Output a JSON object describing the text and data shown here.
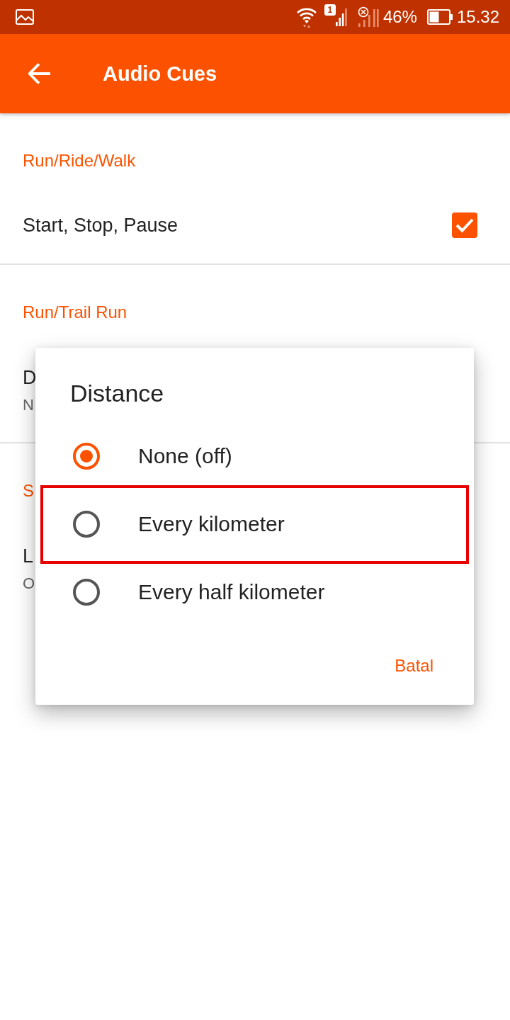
{
  "status_bar": {
    "sim_badge": "1",
    "battery": "46%",
    "time": "15.32"
  },
  "app_bar": {
    "title": "Audio Cues"
  },
  "sections": [
    {
      "header": "Run/Ride/Walk",
      "rows": [
        {
          "kind": "checkbox",
          "title": "Start, Stop, Pause",
          "checked": true
        }
      ]
    },
    {
      "header": "Run/Trail Run",
      "rows": [
        {
          "kind": "value",
          "title": "D",
          "value": "N"
        }
      ]
    },
    {
      "header": "S",
      "rows": [
        {
          "kind": "value",
          "title": "L",
          "value": "O"
        }
      ]
    }
  ],
  "dialog": {
    "title": "Distance",
    "options": [
      {
        "label": "None (off)",
        "selected": true,
        "highlighted": false
      },
      {
        "label": "Every kilometer",
        "selected": false,
        "highlighted": true
      },
      {
        "label": "Every half kilometer",
        "selected": false,
        "highlighted": false
      }
    ],
    "buttons": [
      "Batal"
    ]
  }
}
